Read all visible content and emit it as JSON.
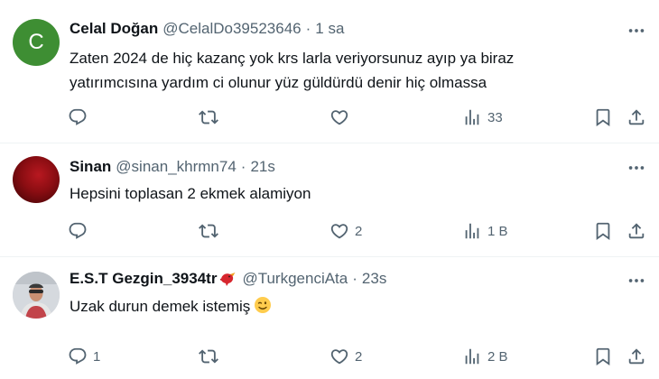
{
  "tweets": [
    {
      "avatar_letter": "C",
      "name": "Celal Doğan",
      "handle": "@CelalDo39523646",
      "time": "1 sa",
      "text_line1": "Zaten 2024 de hiç kazanç yok  krs larla veriyorsunuz  ayıp ya biraz",
      "text_line2": "yatırımcısına yardım ci olunur yüz güldürdü  denir hiç olmassa",
      "replies": "",
      "retweets": "",
      "likes": "",
      "views": "33"
    },
    {
      "name": "Sinan",
      "handle": "@sinan_khrmn74",
      "time": "21s",
      "text": "Hepsini toplasan 2 ekmek alamiyon",
      "replies": "",
      "retweets": "",
      "likes": "2",
      "views": "1 B"
    },
    {
      "name": "E.S.T Gezgin_3934tr",
      "handle": "@TurkgenciAta",
      "time": "23s",
      "text": "Uzak durun demek istemiş",
      "replies": "1",
      "retweets": "",
      "likes": "2",
      "views": "2 B"
    }
  ],
  "separator": "·",
  "colors": {
    "name_text": "#0f1419",
    "muted_text": "#536471",
    "divider": "#eff3f4",
    "avatar_green": "#3e8e33"
  },
  "icons": [
    "reply-icon",
    "retweet-icon",
    "like-icon",
    "views-icon",
    "bookmark-icon",
    "share-icon",
    "more-icon",
    "bird-emoji-icon",
    "winking-face-emoji-icon"
  ]
}
